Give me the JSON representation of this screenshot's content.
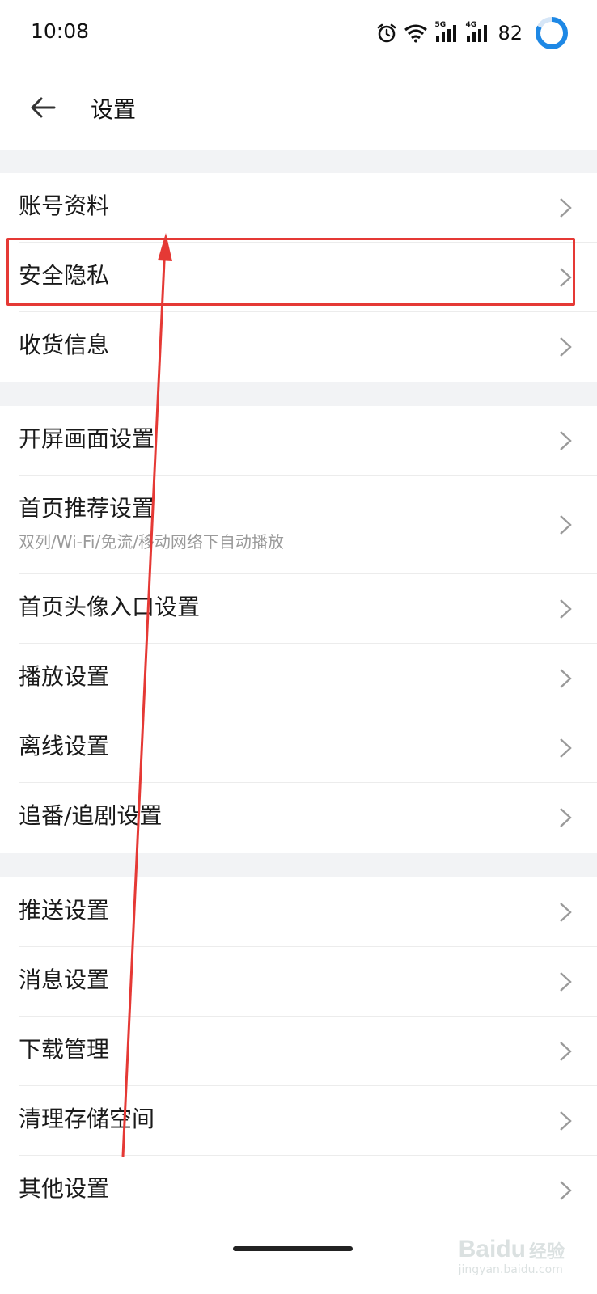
{
  "status_bar": {
    "time": "10:08",
    "battery": "82",
    "icons": [
      "alarm-icon",
      "wifi-icon",
      "signal-5g-icon",
      "signal-4g-icon",
      "battery-ring-icon"
    ],
    "net1": "5G",
    "net2": "4G"
  },
  "header": {
    "title": "设置",
    "back_icon": "arrow-left-icon"
  },
  "groups": [
    {
      "items": [
        {
          "label": "账号资料"
        },
        {
          "label": "安全隐私"
        },
        {
          "label": "收货信息"
        }
      ]
    },
    {
      "items": [
        {
          "label": "开屏画面设置"
        },
        {
          "label": "首页推荐设置",
          "sublabel": "双列/Wi-Fi/免流/移动网络下自动播放"
        },
        {
          "label": "首页头像入口设置"
        },
        {
          "label": "播放设置"
        },
        {
          "label": "离线设置"
        },
        {
          "label": "追番/追剧设置"
        }
      ]
    },
    {
      "items": [
        {
          "label": "推送设置"
        },
        {
          "label": "消息设置"
        },
        {
          "label": "下载管理"
        },
        {
          "label": "清理存储空间"
        },
        {
          "label": "其他设置"
        }
      ]
    }
  ],
  "watermark": {
    "logo": "Baidu",
    "brand": "经验",
    "url": "jingyan.baidu.com"
  },
  "colors": {
    "highlight": "#e53935",
    "battery_ring": "#1e88e5",
    "gap": "#f2f3f5"
  }
}
